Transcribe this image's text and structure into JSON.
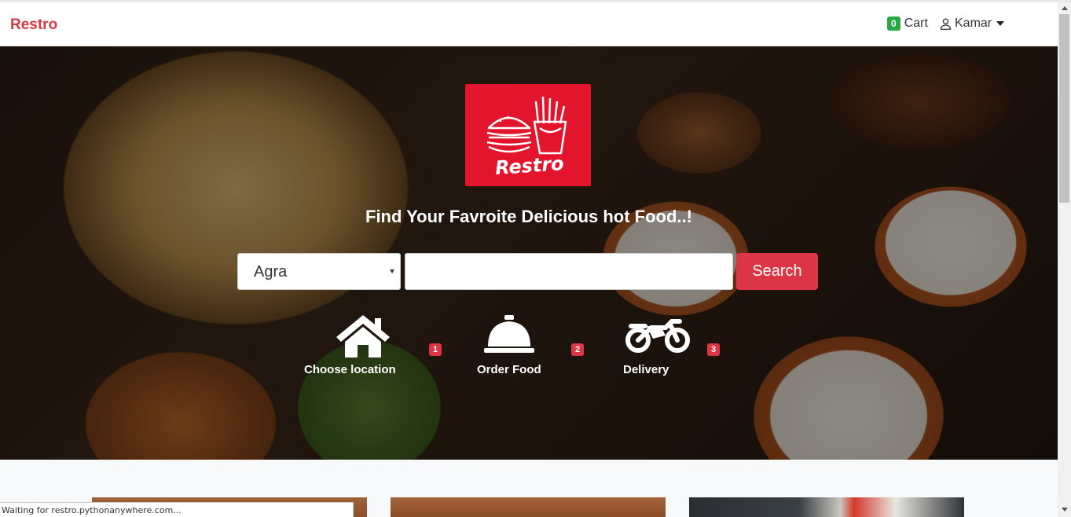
{
  "navbar": {
    "brand": "Restro",
    "cart_count": "0",
    "cart_label": "Cart",
    "user_name": "Kamar"
  },
  "hero": {
    "logo_text": "Restro",
    "tagline": "Find Your Favroite Delicious hot Food..!",
    "city_selected": "Agra",
    "search_placeholder": "",
    "search_button": "Search",
    "steps": [
      {
        "label": "Choose location",
        "number": "1",
        "icon": "home-icon"
      },
      {
        "label": "Order Food",
        "number": "2",
        "icon": "service-bell-icon"
      },
      {
        "label": "Delivery",
        "number": "3",
        "icon": "motorcycle-icon"
      }
    ]
  },
  "status_bar": "Waiting for restro.pythonanywhere.com...",
  "colors": {
    "brand_red": "#dc3545",
    "cart_badge_green": "#28a745",
    "logo_red": "#e3152d"
  }
}
